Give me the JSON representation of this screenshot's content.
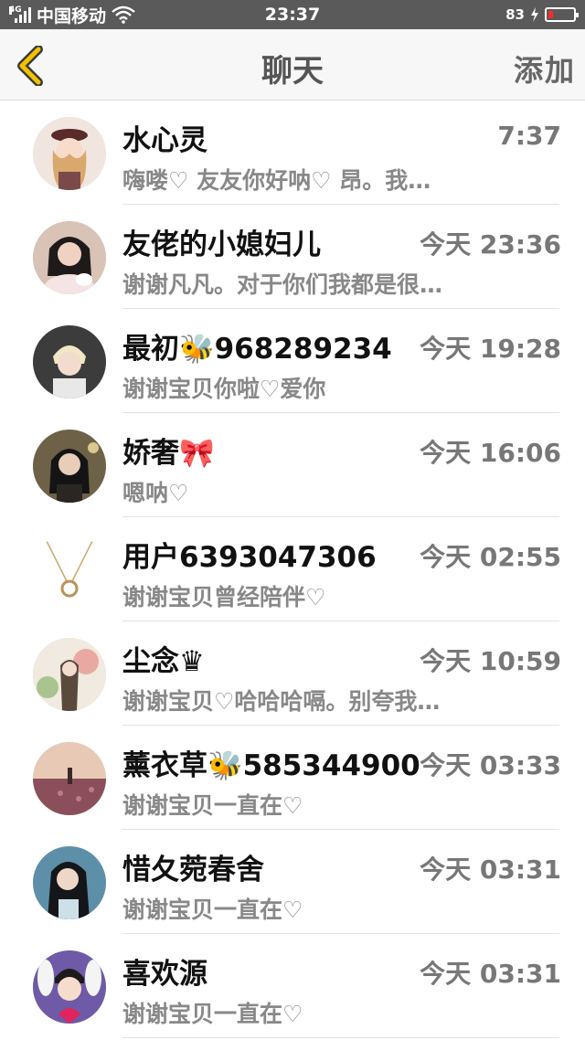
{
  "status_bar": {
    "network": "4G",
    "carrier": "中国移动",
    "time": "23:37",
    "speed": "83",
    "battery_color": "#ff2a2a",
    "battery_level": 0.18
  },
  "header": {
    "title": "聊天",
    "add_label": "添加",
    "accent": "#f2c200"
  },
  "chats": [
    {
      "name": "水心灵",
      "time": "7:37",
      "preview": "嗨喽♡ 友友你好呐♡ 昂。我…",
      "avatar": "avatar-anime-girl"
    },
    {
      "name": "友佬的小媳妇儿",
      "time": "今天 23:36",
      "preview": "谢谢凡凡。对于你们我都是很…",
      "avatar": "avatar-girl-with-cat"
    },
    {
      "name": "最初🐝968289234",
      "time": "今天 19:28",
      "preview": "谢谢宝贝你啦♡爱你",
      "avatar": "avatar-blond-boy"
    },
    {
      "name": "娇奢🎀",
      "time": "今天 16:06",
      "preview": "嗯呐♡",
      "avatar": "avatar-girl-dark"
    },
    {
      "name": "用户6393047306",
      "time": "今天 02:55",
      "preview": "谢谢宝贝曾经陪伴♡",
      "avatar": "avatar-ring-necklace"
    },
    {
      "name": "尘念♛",
      "time": "今天 10:59",
      "preview": "谢谢宝贝♡哈哈哈嗝。别夸我…",
      "avatar": "avatar-flower-girl"
    },
    {
      "name": "薰衣草🐝585344900",
      "time": "今天 03:33",
      "preview": "谢谢宝贝一直在♡",
      "avatar": "avatar-lavender-field"
    },
    {
      "name": "惜夂菀春舍",
      "time": "今天 03:31",
      "preview": "谢谢宝贝一直在♡",
      "avatar": "avatar-girl-sea"
    },
    {
      "name": "喜欢源",
      "time": "今天 03:31",
      "preview": "谢谢宝贝一直在♡",
      "avatar": "avatar-boy-heart"
    }
  ]
}
